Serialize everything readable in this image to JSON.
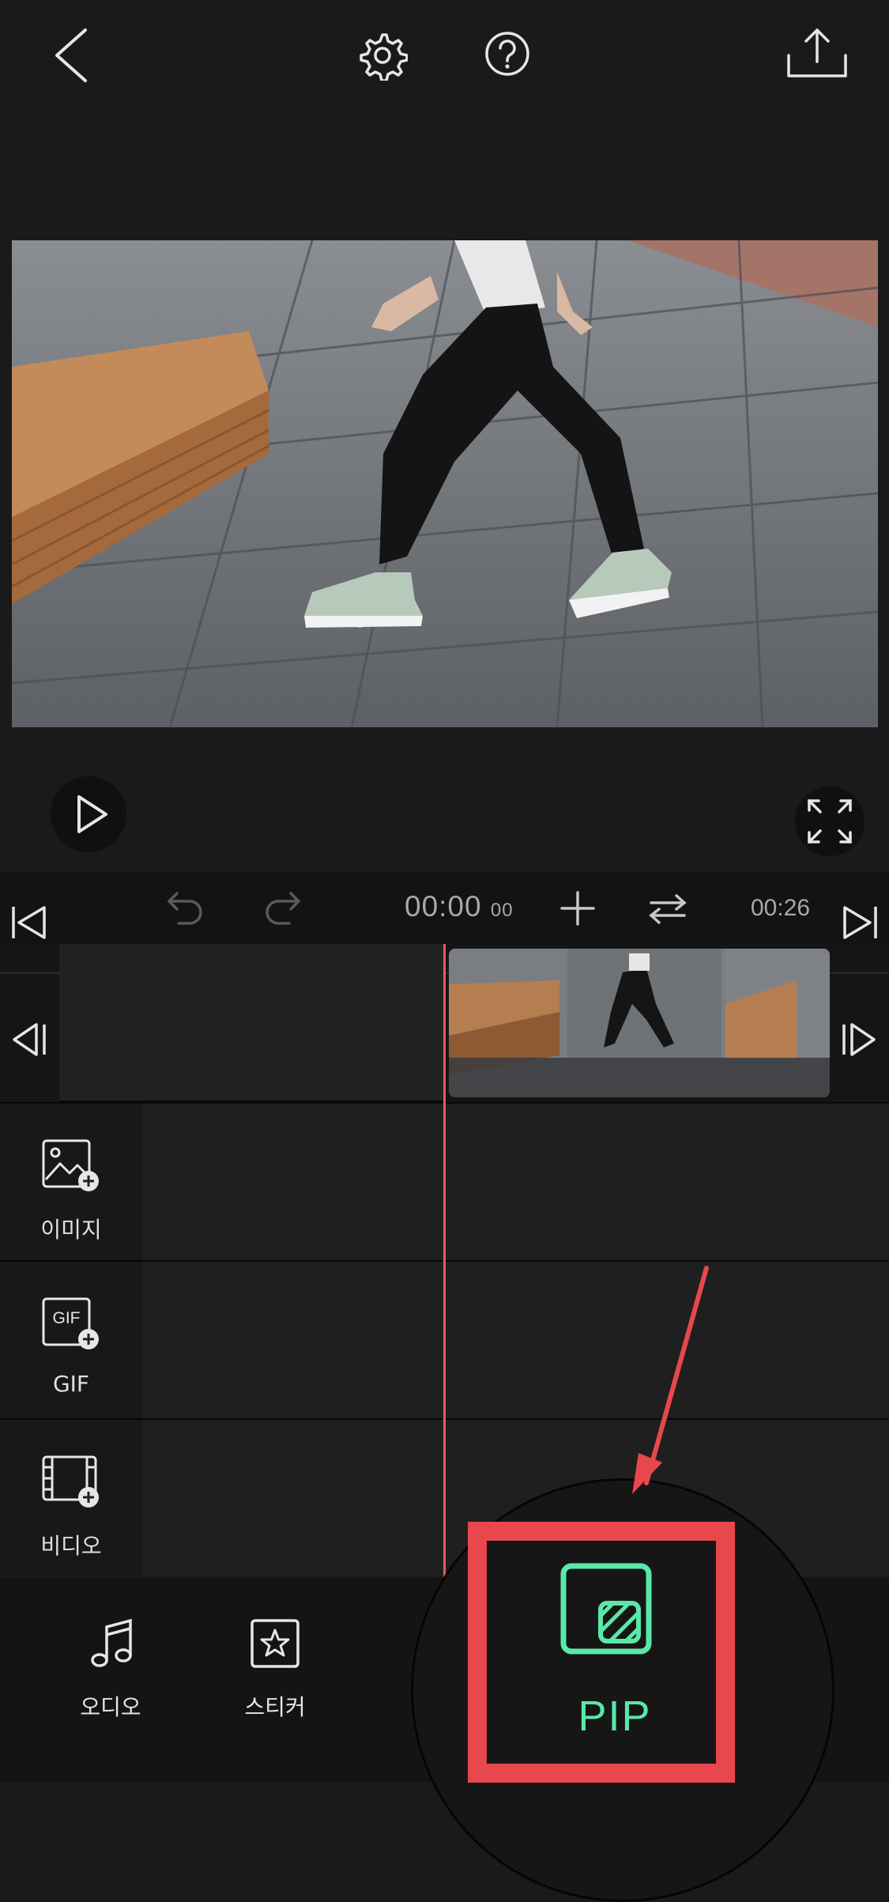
{
  "topbar": {
    "icons": [
      "back-chevron-icon",
      "settings-gear-icon",
      "help-icon",
      "export-share-icon"
    ]
  },
  "player": {
    "play_icon": "play-icon",
    "fullscreen_icon": "fullscreen-icon"
  },
  "timeline": {
    "current_time": "00:00",
    "current_frames": "00",
    "end_time": "00:26"
  },
  "lanes": [
    {
      "label": "이미지",
      "icon": "image-add-icon"
    },
    {
      "label": "GIF",
      "icon": "gif-add-icon",
      "icon_text": "GIF"
    },
    {
      "label": "비디오",
      "icon": "video-add-icon"
    }
  ],
  "bottom_tools": [
    {
      "label": "오디오",
      "icon": "music-note-icon"
    },
    {
      "label": "스티커",
      "icon": "sticker-star-icon"
    },
    {
      "label": "PIP",
      "icon": "pip-icon",
      "highlighted": true
    }
  ],
  "colors": {
    "background": "#1a1a1a",
    "playhead": "#e85a5f",
    "highlight_frame": "#e8474d",
    "pip_accent": "#59e8a8"
  }
}
